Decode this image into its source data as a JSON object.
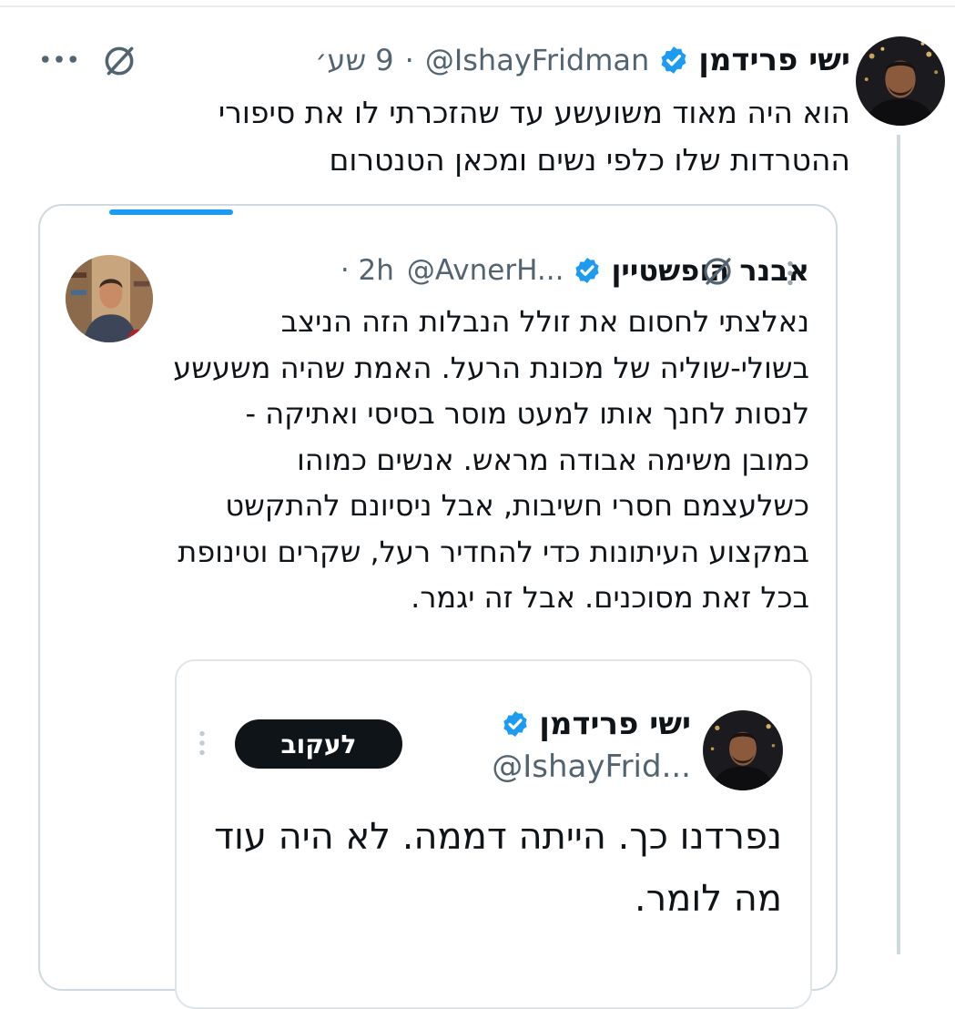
{
  "tweet": {
    "author_name": "ישי פרידמן",
    "handle": "@IshayFridman",
    "separator": "·",
    "time": "9 שע׳",
    "text": "הוא היה מאוד משועשע עד שהזכרתי לו את סיפורי ההטרדות שלו כלפי נשים ומכאן הטנטרום",
    "icons": {
      "verified": "verified-badge-icon",
      "grok": "grok-icon",
      "more": "more-icon"
    },
    "colors": {
      "verified": "#1d9bf0",
      "text": "#0f1419",
      "secondary": "#536471"
    }
  },
  "quoted": {
    "author_name": "אבנר הופשטיין",
    "handle": "@AvnerH...",
    "time": "· 2h",
    "text": "נאלצתי לחסום את זולל הנבלות הזה הניצב בשולי-שוליה של מכונת הרעל. האמת שהיה משעשע לנסות לחנך אותו למעט מוסר בסיסי ואתיקה - כמובן משימה אבודה מראש.  אנשים כמוהו כשלעצמם  חסרי חשיבות, אבל ניסיונם להתקשט במקצוע העיתונות כדי להחדיר רעל, שקרים וטינופת בכל זאת מסוכנים. אבל זה יגמר.",
    "icons": {
      "verified": "verified-badge-icon",
      "grok": "grok-icon",
      "more": "vertical-more-icon"
    }
  },
  "embedded": {
    "author_name": "ישי פרידמן",
    "handle": "@IshayFrid...",
    "follow_label": "לעקוב",
    "text": "נפרדנו כך. הייתה דממה. לא היה עוד מה לומר."
  }
}
